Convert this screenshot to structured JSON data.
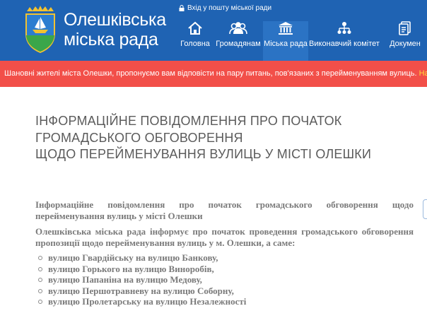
{
  "header": {
    "brand_line1": "Олешківська",
    "brand_line2": "міська рада",
    "mail_link": "Вхід у пошту міської ради",
    "nav": [
      {
        "label": "Головна",
        "icon": "home-icon"
      },
      {
        "label": "Громадянам",
        "icon": "people-icon"
      },
      {
        "label": "Міська рада",
        "icon": "building-icon"
      },
      {
        "label": "Виконавчий комітет",
        "icon": "org-chart-icon"
      },
      {
        "label": "Докумен",
        "icon": "document-icon"
      }
    ]
  },
  "alert": {
    "text": "Шановні жителі міста Олешки, пропонуємо вам відповісти на пару питань, пов'язаних з перейменуванням вулиць. ",
    "cta": "Натисніть тут щоб"
  },
  "article": {
    "title_lines": [
      "ІНФОРМАЦІЙНЕ ПОВІДОМЛЕННЯ ПРО ПОЧАТОК",
      "ГРОМАДСЬКОГО ОБГОВОРЕННЯ",
      "ЩОДО ПЕРЕЙМЕНУВАННЯ ВУЛИЦЬ У МІСТІ ОЛЕШКИ"
    ],
    "para1": "Інформаційне повідомлення про початок громадського обговорення щодо перейменування вулиць у місті Олешки",
    "para2": "Олешківська міська рада інформує про початок проведення громадського обговорення пропозиції щодо перейменування вулиць у м. Олешки, а саме:",
    "streets": [
      "вулицю Гвардійську на вулицю Банкову,",
      "вулицю Горького на вулицю Виноробів,",
      "вулицю Папаніна на вулицю Медову,",
      "вулицю Першотравневу на вулицю Соборну,",
      "вулицю Пролетарську на вулицю Незалежності"
    ]
  },
  "colors": {
    "header_bg": "#1f63b3",
    "alert_bg": "#f24f49",
    "alert_cta": "#ffdb3b",
    "title_text": "#5b5b5b",
    "body_text": "#7a7a7a"
  }
}
